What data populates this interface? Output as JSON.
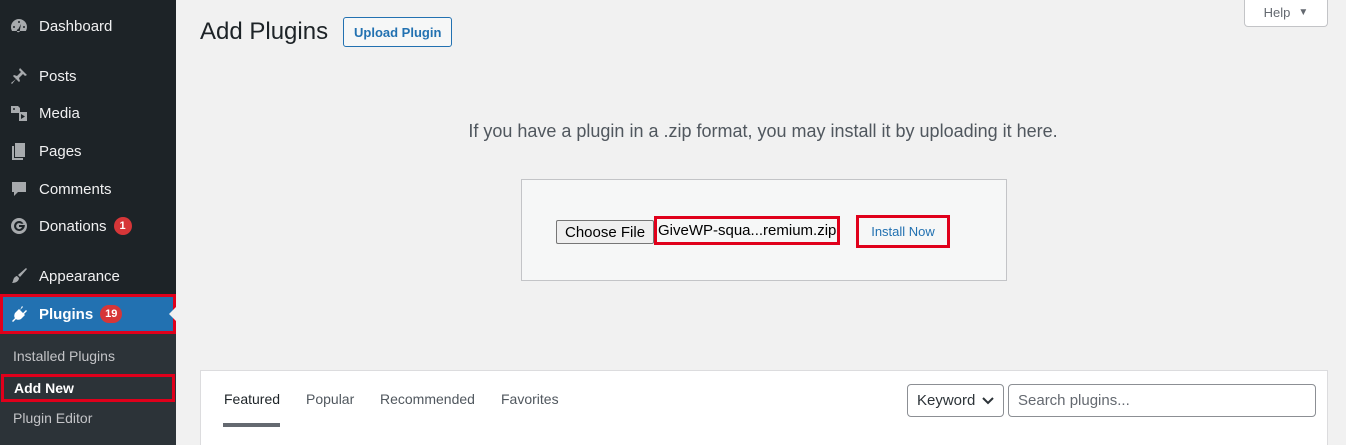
{
  "sidebar": {
    "items": [
      {
        "label": "Dashboard",
        "icon": "dashboard-icon"
      },
      {
        "label": "Posts",
        "icon": "pushpin-icon"
      },
      {
        "label": "Media",
        "icon": "media-icon"
      },
      {
        "label": "Pages",
        "icon": "pages-icon"
      },
      {
        "label": "Comments",
        "icon": "comment-icon"
      },
      {
        "label": "Donations",
        "icon": "give-icon",
        "badge": "1"
      },
      {
        "label": "Appearance",
        "icon": "paintbrush-icon"
      },
      {
        "label": "Plugins",
        "icon": "plugin-icon",
        "badge": "19"
      }
    ],
    "submenu": [
      "Installed Plugins",
      "Add New",
      "Plugin Editor"
    ]
  },
  "header": {
    "title": "Add Plugins",
    "upload_button": "Upload Plugin",
    "help": "Help"
  },
  "upload": {
    "instructions": "If you have a plugin in a .zip format, you may install it by uploading it here.",
    "choose_file": "Choose File",
    "file_name": "GiveWP-squa...remium.zip",
    "install_button": "Install Now"
  },
  "filters": {
    "tabs": [
      "Featured",
      "Popular",
      "Recommended",
      "Favorites"
    ],
    "search_type": "Keyword",
    "search_placeholder": "Search plugins..."
  },
  "colors": {
    "sidebar_bg": "#1d2327",
    "active_bg": "#2271b1",
    "highlight": "#e0001b",
    "badge": "#d63638"
  }
}
